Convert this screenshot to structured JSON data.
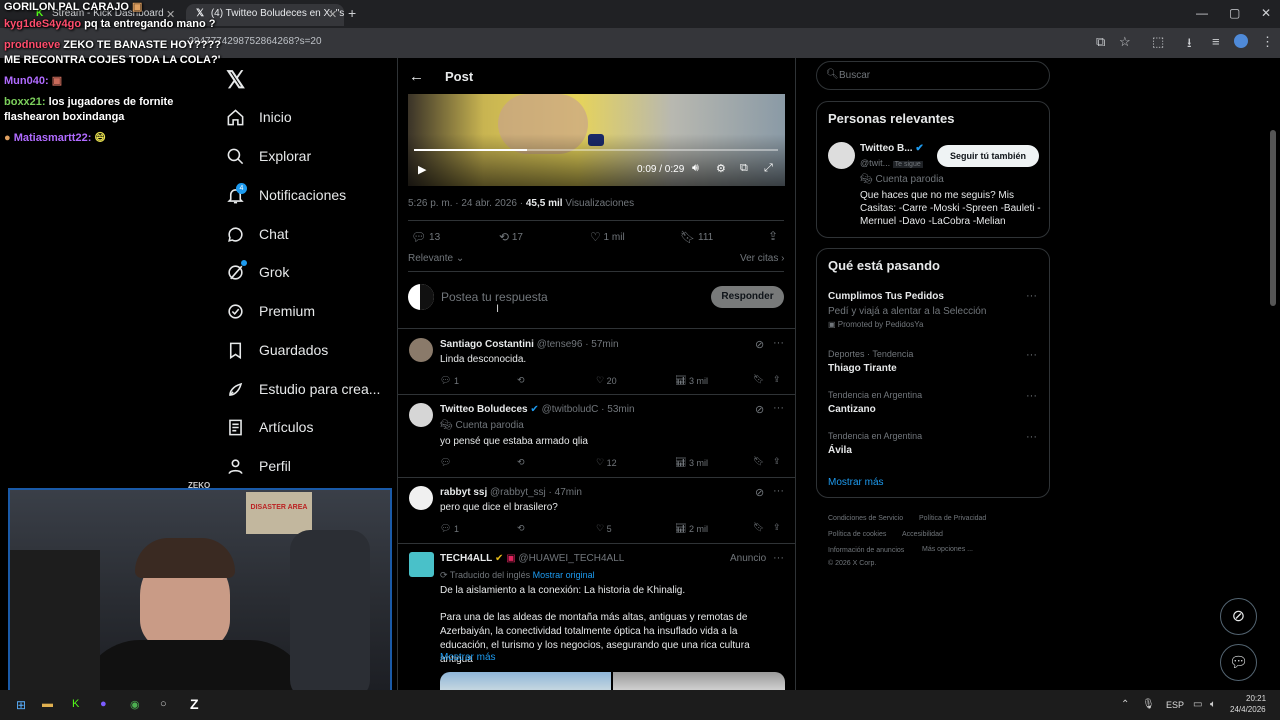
{
  "browser": {
    "tabs": [
      {
        "label": "Stream - Kick Dashboard"
      },
      {
        "label": "(4) Twitteo Boludeces en X: \"se"
      }
    ],
    "url": "...2947774298752864268?s=20"
  },
  "stream_chat": {
    "title": "GORILON PAL CARAJO",
    "messages": [
      {
        "user": "kyg1deS4y4go",
        "text": "pq ta entregando mano ?",
        "color": "#ff4d6d"
      },
      {
        "user": "prodnueve",
        "text": "ZEKO TE BANASTE HOY????",
        "color": "#ff4d6d"
      },
      {
        "user": "",
        "text": "ME RECONTRA COJES TODA LA COLA?'",
        "color": "#ffffff"
      },
      {
        "user": "Mun040:",
        "text": "",
        "color": "#b06bff"
      },
      {
        "user": "boxx21:",
        "text": "los jugadores de fornite flashearon boxindanga",
        "color": "#7cd05c"
      },
      {
        "user": "Matiasmartt22:",
        "text": "",
        "color": "#b06bff"
      }
    ],
    "cam_label": "ZEKO",
    "cam_poster": "DISASTER AREA"
  },
  "sidebar": {
    "items": [
      {
        "label": "Inicio",
        "icon": "home-icon"
      },
      {
        "label": "Explorar",
        "icon": "search-icon"
      },
      {
        "label": "Notificaciones",
        "icon": "bell-icon",
        "badge": "4"
      },
      {
        "label": "Chat",
        "icon": "chat-icon"
      },
      {
        "label": "Grok",
        "icon": "grok-icon"
      },
      {
        "label": "Premium",
        "icon": "premium-icon"
      },
      {
        "label": "Guardados",
        "icon": "bookmark-icon"
      },
      {
        "label": "Estudio para crea...",
        "icon": "rocket-icon"
      },
      {
        "label": "Artículos",
        "icon": "article-icon"
      },
      {
        "label": "Perfil",
        "icon": "person-icon"
      }
    ]
  },
  "post": {
    "header": "Post",
    "video_time": "0:09 / 0:29",
    "timestamp": "5:26 p. m. · 24 abr. 2026 · ",
    "views_count": "45,5 mil",
    "views_label": "Visualizaciones",
    "replies": "13",
    "reposts": "17",
    "likes": "1 mil",
    "bookmarks": "111",
    "sort_label": "Relevante",
    "quotes_label": "Ver citas",
    "reply_placeholder": "Postea tu respuesta",
    "reply_button": "Responder"
  },
  "replies": [
    {
      "name": "Santiago Costantini",
      "handle": "@tense96 · 57min",
      "text": "Linda desconocida.",
      "replies": "1",
      "likes": "20",
      "views": "3 mil"
    },
    {
      "name": "Twitteo Boludeces",
      "handle": "@twitbolud​C · 53min",
      "badge": "Cuenta parodia",
      "text": "yo pensé que estaba armado qlia",
      "replies": "",
      "likes": "12",
      "views": "3 mil"
    },
    {
      "name": "rabbyt ssj",
      "handle": "@rabbyt_ssj · 47min",
      "text": "pero que dice el brasilero?",
      "replies": "1",
      "likes": "5",
      "views": "2 mil"
    }
  ],
  "ad": {
    "name": "TECH4ALL",
    "handle": "@HUAWEI_TECH4ALL",
    "tag": "Anuncio",
    "translated": "Traducido del inglés",
    "show_original": "Mostrar original",
    "title": "De la aislamiento a la conexión: La historia de Khinalig.",
    "body": "Para una de las aldeas de montaña más altas, antiguas y remotas de Azerbaiyán, la conectividad totalmente óptica ha insuflado vida a la educación, el turismo y los negocios, asegurando que una rica cultura antigua",
    "more": "Mostrar más"
  },
  "right": {
    "search_placeholder": "Buscar",
    "relevant_title": "Personas relevantes",
    "person": {
      "name": "Twitteo B...",
      "handle": "@twit...",
      "follows_you": "Te sigue",
      "badge": "Cuenta parodia",
      "button": "Seguir tú también",
      "bio": "Que haces que no me seguis? Mis Casitas: -Carre -Moski -Spreen -Bauleti -Mernuel -Davo -LaCobra -Melian"
    },
    "trends_title": "Qué está pasando",
    "trends": [
      {
        "category": "",
        "name": "Cumplimos Tus Pedidos",
        "sub": "Pedí y viajá a alentar a la Selección",
        "promo": "Promoted by PedidosYa"
      },
      {
        "category": "Deportes · Tendencia",
        "name": "Thiago Tirante"
      },
      {
        "category": "Tendencia en Argentina",
        "name": "Cantizano"
      },
      {
        "category": "Tendencia en Argentina",
        "name": "Ávila"
      }
    ],
    "show_more": "Mostrar más",
    "footer": [
      "Condiciones de Servicio",
      "Política de Privacidad",
      "Política de cookies",
      "Accesibilidad",
      "Información de anuncios",
      "Más opciones ...",
      "© 2026 X Corp."
    ]
  },
  "taskbar": {
    "lang": "ESP",
    "time": "20:21",
    "date": "24/4/2026"
  },
  "colors": {
    "accent": "#1d9bf0",
    "verified": "#1d9bf0",
    "gold": "#e2b719"
  }
}
